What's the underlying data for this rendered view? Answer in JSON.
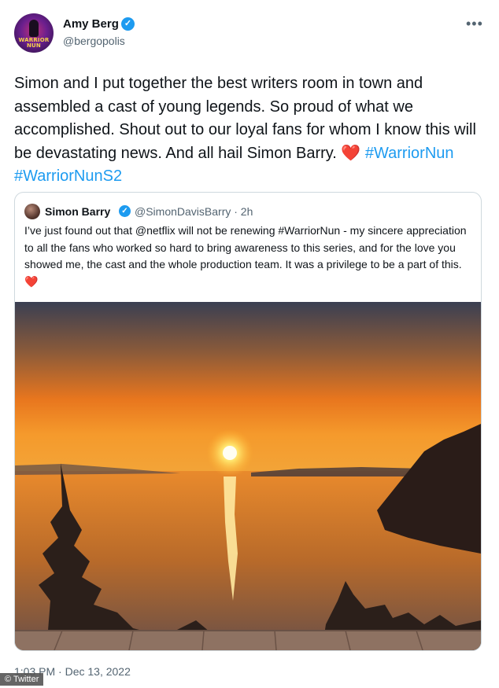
{
  "author": {
    "name": "Amy Berg",
    "handle": "@bergopolis",
    "avatar_text": "WARRIOR NUN"
  },
  "more_icon": "more-horizontal-icon",
  "tweet": {
    "text": "Simon and I put together the best writers room in town and assembled a cast of young legends. So proud of what we accomplished. Shout out to our loyal fans for whom I know this will be devastating news. And all hail Simon Barry.",
    "heart": "❤️",
    "hashtags": [
      "#WarriorNun",
      "#WarriorNunS2"
    ]
  },
  "quoted": {
    "name": "Simon Barry",
    "handle_time": "@SimonDavisBarry · 2h",
    "text": "I’ve just found out that @netflix will not be renewing #WarriorNun - my sincere appreciation to all the fans who worked so hard to bring awareness to this series, and for the love you showed me, the cast and the whole production team. It was a privilege to be a part of this.",
    "heart": "❤️"
  },
  "timestamp": "1:03 PM · Dec 13, 2022",
  "watermark": "© Twitter",
  "colors": {
    "accent": "#1d9bf0",
    "secondary_text": "#536471",
    "heart": "#e0245e"
  }
}
